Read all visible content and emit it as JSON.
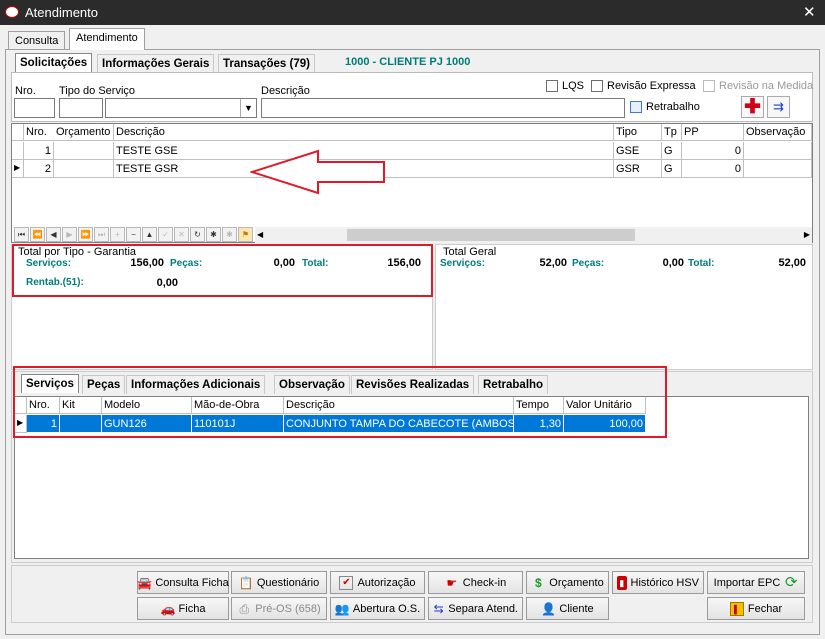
{
  "window": {
    "title": "Atendimento",
    "close": "✕"
  },
  "top_tabs": [
    {
      "label": "Consulta"
    },
    {
      "label": "Atendimento"
    }
  ],
  "form_tabs": [
    {
      "label": "Solicitações"
    },
    {
      "label": "Informações Gerais"
    },
    {
      "label": "Transações (79)"
    }
  ],
  "client_label": "1000 - CLIENTE PJ 1000",
  "fields": {
    "nro": "Nro.",
    "tipo_servico": "Tipo do Serviço",
    "descricao": "Descrição"
  },
  "checks": {
    "lqs": "LQS",
    "revisao_expressa": "Revisão Expressa",
    "revisao_medida": "Revisão na Medida",
    "retrabalho": "Retrabalho"
  },
  "grid1": {
    "columns": [
      "Nro.",
      "Orçamento",
      "Descrição",
      "Tipo",
      "Tp",
      "PP",
      "Observação"
    ],
    "rows": [
      {
        "nro": "1",
        "orcamento": "",
        "descricao": "TESTE GSE",
        "tipo": "GSE",
        "tp": "G",
        "pp": "0",
        "obs": ""
      },
      {
        "nro": "2",
        "orcamento": "",
        "descricao": "TESTE GSR",
        "tipo": "GSR",
        "tp": "G",
        "pp": "0",
        "obs": ""
      }
    ],
    "row_indicator": "▶"
  },
  "nav": [
    "⏮",
    "⏪",
    "◀",
    "▶",
    "⏩",
    "⏭",
    "+",
    "−",
    "▲",
    "✓",
    "✕",
    "↻",
    "✱",
    "✱",
    "⚑"
  ],
  "totals_tipo": {
    "title": "Total por Tipo - Garantia",
    "servicos_label": "Serviços:",
    "servicos": "156,00",
    "pecas_label": "Peças:",
    "pecas": "0,00",
    "total_label": "Total:",
    "total": "156,00",
    "rentab_label": "Rentab.(51):",
    "rentab": "0,00"
  },
  "totals_geral": {
    "title": "Total Geral",
    "servicos_label": "Serviços:",
    "servicos": "52,00",
    "pecas_label": "Peças:",
    "pecas": "0,00",
    "total_label": "Total:",
    "total": "52,00"
  },
  "bottom_tabs": [
    {
      "label": "Serviços"
    },
    {
      "label": "Peças"
    },
    {
      "label": "Informações Adicionais"
    },
    {
      "label": "Observação"
    },
    {
      "label": "Revisões Realizadas"
    },
    {
      "label": "Retrabalho"
    }
  ],
  "grid2": {
    "columns": [
      "Nro.",
      "Kit",
      "Modelo",
      "Mão-de-Obra",
      "Descrição",
      "Tempo",
      "Valor Unitário"
    ],
    "rows": [
      {
        "nro": "1",
        "kit": "",
        "modelo": "GUN126",
        "mao": "110101J",
        "descricao": "CONJUNTO TAMPA DO CABECOTE (AMBOS O",
        "tempo": "1,30",
        "valor": "100,00"
      }
    ]
  },
  "buttons": {
    "consulta_ficha": "Consulta Ficha",
    "questionario": "Questionário",
    "autorizacao": "Autorização",
    "checkin": "Check-in",
    "orcamento": "Orçamento",
    "historico": "Histórico HSV",
    "importar": "Importar EPC",
    "ficha": "Ficha",
    "preos": "Pré-OS (658)",
    "abertura": "Abertura O.S.",
    "separa": "Separa Atend.",
    "cliente": "Cliente",
    "fechar": "Fechar"
  },
  "colors": {
    "accent_teal": "#007b7b",
    "highlight_red": "#e11a2a",
    "selection_blue": "#0078d7"
  }
}
